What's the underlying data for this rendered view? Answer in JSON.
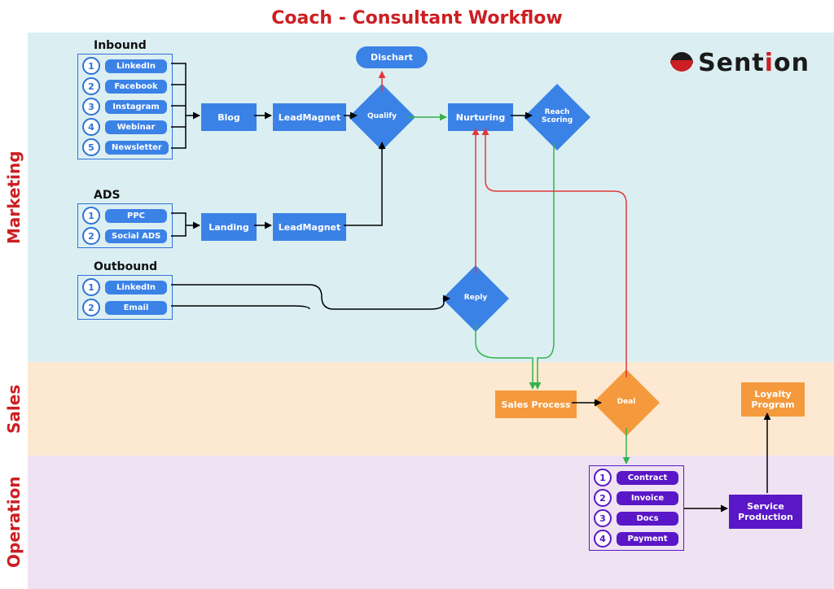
{
  "title": "Coach - Consultant Workflow",
  "brand": "Sention",
  "lanes": {
    "marketing": "Marketing",
    "sales": "Sales",
    "operation": "Operation"
  },
  "groups": {
    "inbound": {
      "title": "Inbound",
      "items": [
        "LinkedIn",
        "Facebook",
        "Instagram",
        "Webinar",
        "Newsletter"
      ]
    },
    "ads": {
      "title": "ADS",
      "items": [
        "PPC",
        "Social ADS"
      ]
    },
    "outbound": {
      "title": "Outbound",
      "items": [
        "LinkedIn",
        "Email"
      ]
    },
    "ops": {
      "items": [
        "Contract",
        "Invoice",
        "Docs",
        "Payment"
      ]
    }
  },
  "nodes": {
    "blog": "Blog",
    "leadmagnet1": "LeadMagnet",
    "landing": "Landing",
    "leadmagnet2": "LeadMagnet",
    "qualify": "Qualify",
    "dischart": "Dischart",
    "nurturing": "Nurturing",
    "reachscoring": "Reach Scoring",
    "reply": "Reply",
    "salesprocess": "Sales Process",
    "deal": "Deal",
    "serviceprod": "Service Production",
    "loyalty": "Loyalty Program"
  },
  "colors": {
    "blue": "#3b82e7",
    "orange": "#f49a3d",
    "purple": "#5a17c7",
    "red": "#cc1f23",
    "green": "#36b24a"
  }
}
